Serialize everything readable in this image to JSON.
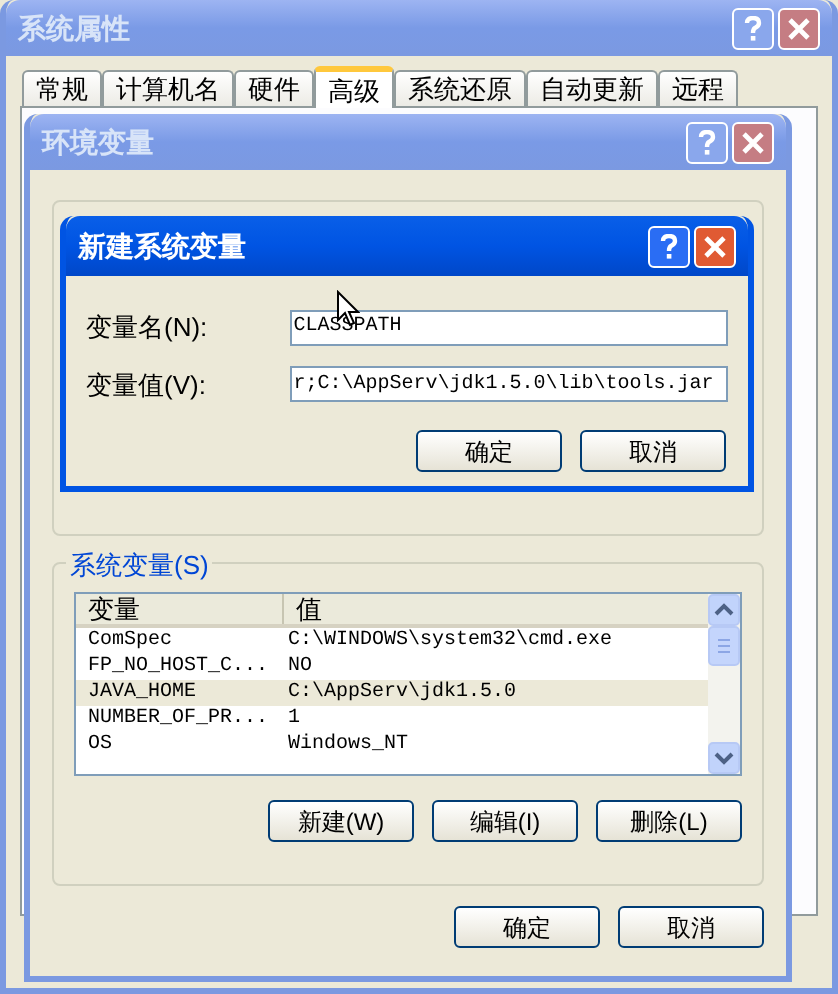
{
  "window": {
    "title": "系统属性",
    "active": false,
    "tabs": [
      {
        "label": "常规",
        "selected": false
      },
      {
        "label": "计算机名",
        "selected": false
      },
      {
        "label": "硬件",
        "selected": false
      },
      {
        "label": "高级",
        "selected": true
      },
      {
        "label": "系统还原",
        "selected": false
      },
      {
        "label": "自动更新",
        "selected": false
      },
      {
        "label": "远程",
        "selected": false
      }
    ]
  },
  "env_window": {
    "title": "环境变量",
    "active": false,
    "system_variables": {
      "label": "系统变量(S)",
      "columns": [
        "变量",
        "值"
      ],
      "rows": [
        {
          "name": "ComSpec",
          "value": "C:\\WINDOWS\\system32\\cmd.exe",
          "selected": false
        },
        {
          "name": "FP_NO_HOST_C...",
          "value": "NO",
          "selected": false
        },
        {
          "name": "JAVA_HOME",
          "value": "C:\\AppServ\\jdk1.5.0",
          "selected": true
        },
        {
          "name": "NUMBER_OF_PR...",
          "value": "1",
          "selected": false
        },
        {
          "name": "OS",
          "value": "Windows_NT",
          "selected": false
        }
      ],
      "buttons": [
        "新建(W)",
        "编辑(I)",
        "删除(L)"
      ]
    },
    "buttons": [
      "确定",
      "取消"
    ]
  },
  "dialog": {
    "title": "新建系统变量",
    "active": true,
    "fields": [
      {
        "label": "变量名(N):",
        "value": "CLASSPATH"
      },
      {
        "label": "变量值(V):",
        "value": "r;C:\\AppServ\\jdk1.5.0\\lib\\tools.jar"
      }
    ],
    "buttons": [
      "确定",
      "取消"
    ]
  }
}
